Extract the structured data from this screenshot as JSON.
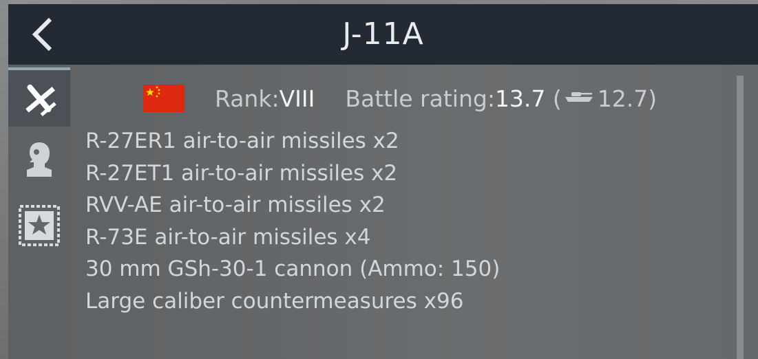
{
  "window": {
    "title": "J-11A",
    "back_icon": "chevron-left-icon"
  },
  "tabs": [
    {
      "name": "aircraft",
      "icon": "plane-icon",
      "active": true
    },
    {
      "name": "crew",
      "icon": "pilot-icon",
      "active": false
    },
    {
      "name": "award",
      "icon": "star-stamp-icon",
      "active": false
    }
  ],
  "info": {
    "flag_icon": "china-flag-icon",
    "rank_label": "Rank: ",
    "rank_value": "VIII",
    "br_label": "Battle rating: ",
    "br_air": "13.7",
    "br_ground_open": "(",
    "br_ground": "12.7)",
    "ground_icon": "tank-icon"
  },
  "weapons": [
    "R-27ER1 air-to-air missiles x2",
    "R-27ET1 air-to-air missiles x2",
    "RVV-AE air-to-air missiles x2",
    "R-73E air-to-air missiles x4",
    "30 mm GSh-30-1 cannon (Ammo: 150)",
    "Large caliber countermeasures x96"
  ],
  "colors": {
    "header_bg": "#232a33",
    "panel_bg": "#646769",
    "active_tab_bg": "#4b5157",
    "active_tab_accent": "#93a6b6",
    "flag_red": "#de2910",
    "flag_yellow": "#ffde00"
  }
}
